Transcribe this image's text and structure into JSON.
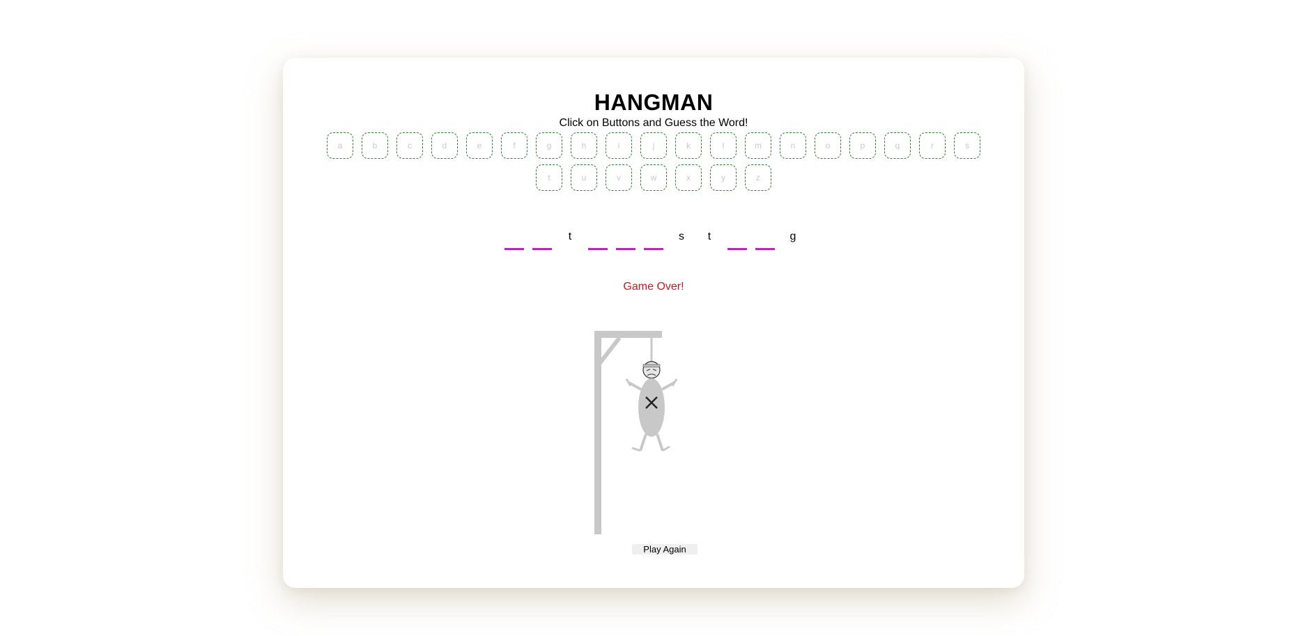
{
  "game": {
    "title": "HANGMAN",
    "subtitle": "Click on Buttons and Guess the Word!",
    "letters": [
      "a",
      "b",
      "c",
      "d",
      "e",
      "f",
      "g",
      "h",
      "i",
      "j",
      "k",
      "l",
      "m",
      "n",
      "o",
      "p",
      "q",
      "r",
      "s",
      "t",
      "u",
      "v",
      "w",
      "x",
      "y",
      "z"
    ],
    "word_slots": [
      "",
      "",
      "t",
      "",
      "",
      "",
      "s",
      "t",
      "",
      "",
      "g"
    ],
    "status": "Game Over!",
    "play_again_label": "Play Again"
  },
  "colors": {
    "key_border": "#2e7d32",
    "dash": "#b02cb8",
    "status": "#d1151c",
    "gallows": "#c8c8c8"
  },
  "icons": [
    "gallows-icon",
    "hanged-man-icon"
  ]
}
